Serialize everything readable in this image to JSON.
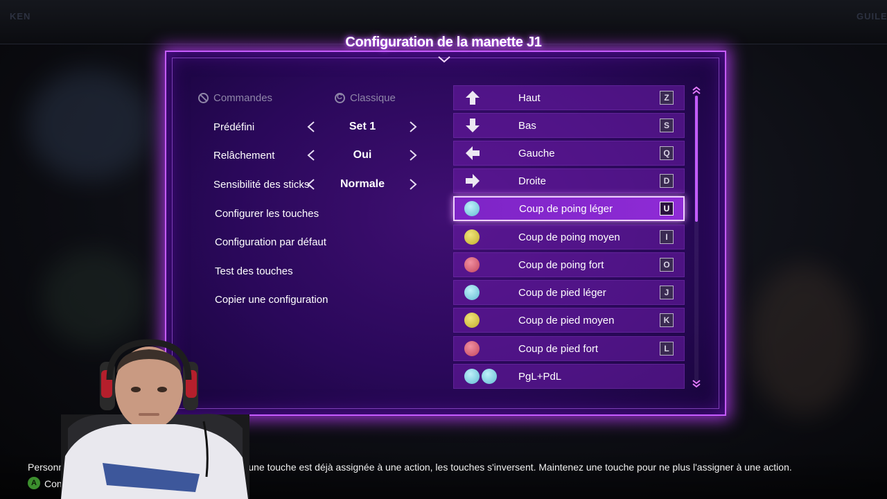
{
  "title": "Configuration de la manette J1",
  "hud": {
    "left": "KEN",
    "right": "GUILE"
  },
  "left_panel": {
    "commands_header": "Commandes",
    "commands_mode": "Classique",
    "settings": [
      {
        "label": "Prédéfini",
        "value": "Set 1"
      },
      {
        "label": "Relâchement",
        "value": "Oui"
      },
      {
        "label": "Sensibilité des sticks",
        "value": "Normale"
      }
    ],
    "menu_items": [
      "Configurer les touches",
      "Configuration par défaut",
      "Test des touches",
      "Copier une configuration"
    ]
  },
  "key_list": [
    {
      "label": "Haut",
      "key": "Z",
      "icon": "arrow-up-icon"
    },
    {
      "label": "Bas",
      "key": "S",
      "icon": "arrow-down-icon"
    },
    {
      "label": "Gauche",
      "key": "Q",
      "icon": "arrow-left-icon"
    },
    {
      "label": "Droite",
      "key": "D",
      "icon": "arrow-right-icon"
    },
    {
      "label": "Coup de poing léger",
      "key": "U",
      "icon": "light-punch-icon",
      "selected": true
    },
    {
      "label": "Coup de poing moyen",
      "key": "I",
      "icon": "medium-punch-icon"
    },
    {
      "label": "Coup de poing fort",
      "key": "O",
      "icon": "heavy-punch-icon"
    },
    {
      "label": "Coup de pied léger",
      "key": "J",
      "icon": "light-kick-icon"
    },
    {
      "label": "Coup de pied moyen",
      "key": "K",
      "icon": "medium-kick-icon"
    },
    {
      "label": "Coup de pied fort",
      "key": "L",
      "icon": "heavy-kick-icon"
    },
    {
      "label": "PgL+PdL",
      "key": "",
      "icon": "lp-lk-combo-icon"
    }
  ],
  "footer": {
    "line1_start": "Personnal",
    "line1_text": "Si une touche est déjà assignée à une action, les touches s'inversent. Maintenez une touche pour ne plus l'assigner à une action.",
    "line2_button": "A",
    "line2_text": "Con"
  },
  "colors": {
    "accent": "#c65cff",
    "panel": "#2a085a",
    "selected_row": "#8f2bd6",
    "light_attack": "#7fd4e6",
    "medium_attack": "#d7c63d",
    "heavy_attack": "#d65b72"
  }
}
